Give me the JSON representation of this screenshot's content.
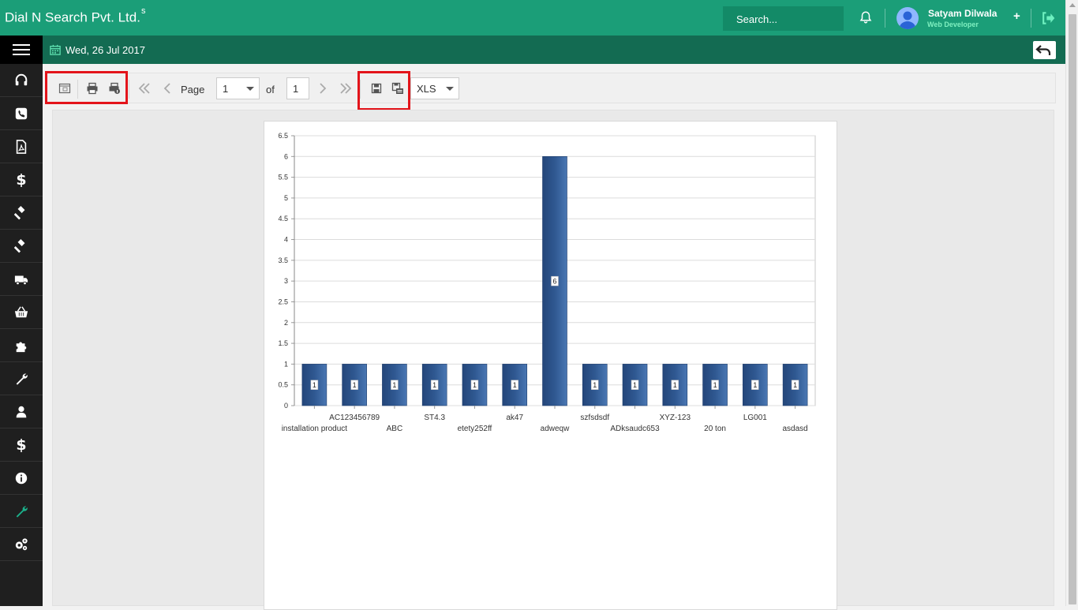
{
  "header": {
    "brand": "Dial N Search Pvt. Ltd.",
    "brand_sup": "s",
    "search_placeholder": "Search...",
    "user_name": "Satyam Dilwala",
    "user_role": "Web Developer",
    "plus": "+"
  },
  "subbar": {
    "date": "Wed, 26 Jul 2017"
  },
  "sidebar": {
    "items": [
      {
        "icon": "headset-icon"
      },
      {
        "icon": "phone-icon"
      },
      {
        "icon": "pdf-file-icon"
      },
      {
        "icon": "dollar-icon",
        "glyph": "$"
      },
      {
        "icon": "gavel-icon"
      },
      {
        "icon": "gavel-icon"
      },
      {
        "icon": "truck-icon"
      },
      {
        "icon": "basket-icon"
      },
      {
        "icon": "puzzle-icon"
      },
      {
        "icon": "wrench-icon"
      },
      {
        "icon": "user-icon"
      },
      {
        "icon": "dollar-icon",
        "glyph": "$"
      },
      {
        "icon": "info-icon"
      },
      {
        "icon": "wrench-icon-active"
      },
      {
        "icon": "gears-icon"
      }
    ]
  },
  "toolbar": {
    "page_label": "Page",
    "page_value": "1",
    "of_label": "of",
    "total_pages": "1",
    "format_value": "XLS"
  },
  "colors": {
    "topbar": "#1b9e78",
    "subbar": "#136b52",
    "sidebar": "#1f1f1f",
    "highlight": "#e3141b",
    "bar": "#2f5891"
  },
  "chart_data": {
    "type": "bar",
    "categories": [
      "installation product",
      "AC123456789",
      "ABC",
      "ST4.3",
      "etety252ff",
      "ak47",
      "adweqw",
      "szfsdsdf",
      "ADksaudc653",
      "XYZ-123",
      "20 ton",
      "LG001",
      "asdasd"
    ],
    "values": [
      1,
      1,
      1,
      1,
      1,
      1,
      6,
      1,
      1,
      1,
      1,
      1,
      1
    ],
    "data_labels": [
      "1",
      "1",
      "1",
      "1",
      "1",
      "1",
      "6",
      "1",
      "1",
      "1",
      "1",
      "1",
      "1"
    ],
    "yticks": [
      "0",
      "0.5",
      "1",
      "1.5",
      "2",
      "2.5",
      "3",
      "3.5",
      "4",
      "4.5",
      "5",
      "5.5",
      "6",
      "6.5"
    ],
    "ylim": [
      0,
      6.5
    ],
    "grid": true,
    "title": "",
    "xlabel": "",
    "ylabel": ""
  }
}
